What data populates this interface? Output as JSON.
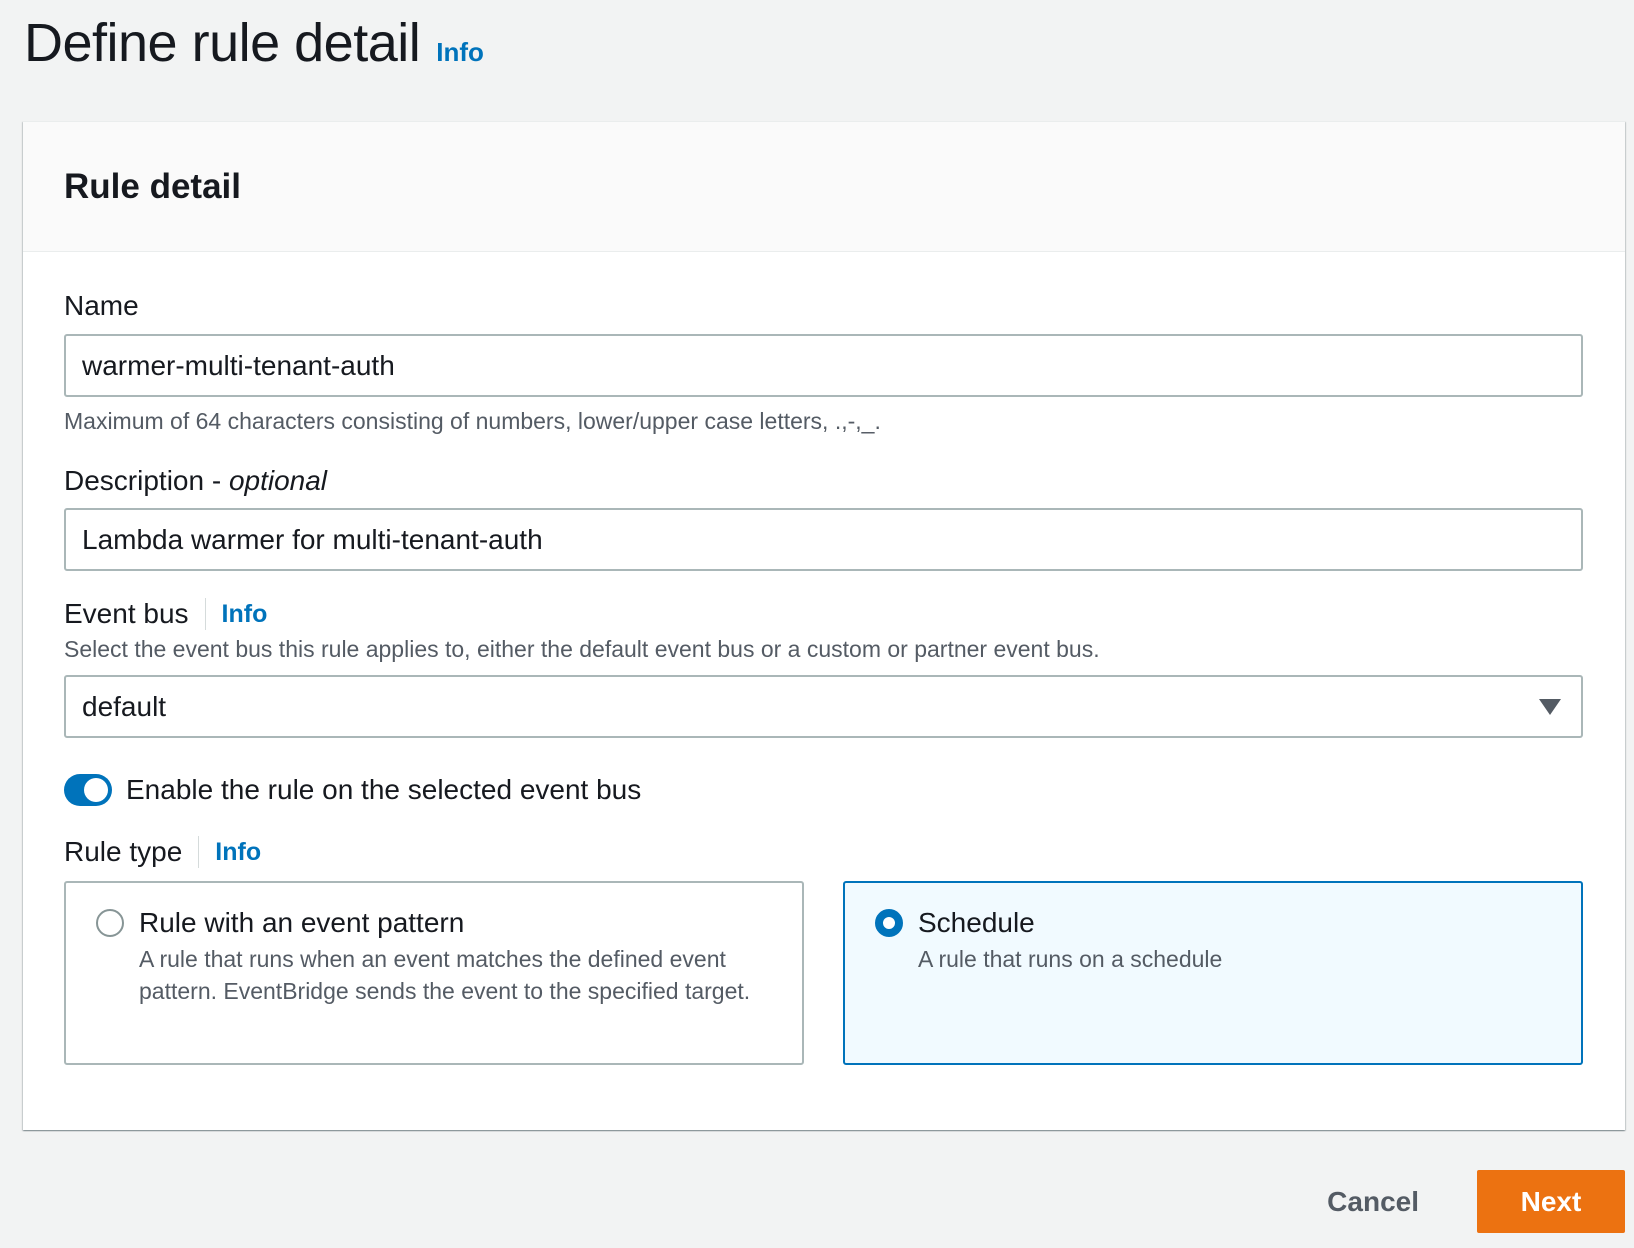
{
  "page": {
    "title": "Define rule detail",
    "info_label": "Info"
  },
  "panel": {
    "title": "Rule detail"
  },
  "name_field": {
    "label": "Name",
    "value": "warmer-multi-tenant-auth",
    "constraint": "Maximum of 64 characters consisting of numbers, lower/upper case letters, .,-,_."
  },
  "description_field": {
    "label": "Description - ",
    "label_optional": "optional",
    "value": "Lambda warmer for multi-tenant-auth"
  },
  "event_bus": {
    "label": "Event bus",
    "info_label": "Info",
    "description": "Select the event bus this rule applies to, either the default event bus or a custom or partner event bus.",
    "selected_value": "default"
  },
  "enable_toggle": {
    "label": "Enable the rule on the selected event bus",
    "checked": true
  },
  "rule_type": {
    "label": "Rule type",
    "info_label": "Info",
    "options": [
      {
        "title": "Rule with an event pattern",
        "description": "A rule that runs when an event matches the defined event pattern. EventBridge sends the event to the specified target.",
        "selected": false
      },
      {
        "title": "Schedule",
        "description": "A rule that runs on a schedule",
        "selected": true
      }
    ]
  },
  "footer": {
    "cancel_label": "Cancel",
    "next_label": "Next"
  },
  "colors": {
    "accent": "#0073bb",
    "primary_button": "#ec7211",
    "background": "#f2f3f3"
  }
}
